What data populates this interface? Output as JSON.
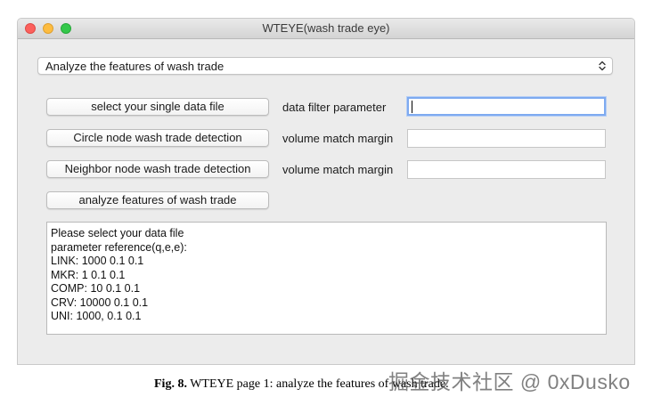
{
  "window": {
    "title": "WTEYE(wash trade eye)"
  },
  "mode_select": {
    "value": "Analyze the features of wash trade"
  },
  "rows": [
    {
      "button_label": "select your single data file",
      "field_label": "data filter parameter",
      "field_value": ""
    },
    {
      "button_label": "Circle node wash trade detection",
      "field_label": "volume match margin",
      "field_value": ""
    },
    {
      "button_label": "Neighbor node wash trade detection",
      "field_label": "volume match margin",
      "field_value": ""
    },
    {
      "button_label": "analyze features of wash trade"
    }
  ],
  "output": {
    "lines": [
      "Please select your data file",
      "parameter reference(q,e,e):",
      "LINK: 1000 0.1 0.1",
      "MKR: 1 0.1 0.1",
      "COMP: 10 0.1 0.1",
      "CRV: 10000 0.1 0.1",
      "UNI: 1000, 0.1 0.1"
    ]
  },
  "caption": {
    "prefix": "Fig. 8.",
    "text": "WTEYE page 1: analyze the features of wash trade."
  },
  "watermark": {
    "text": "掘金技术社区 @ 0xDusko"
  }
}
